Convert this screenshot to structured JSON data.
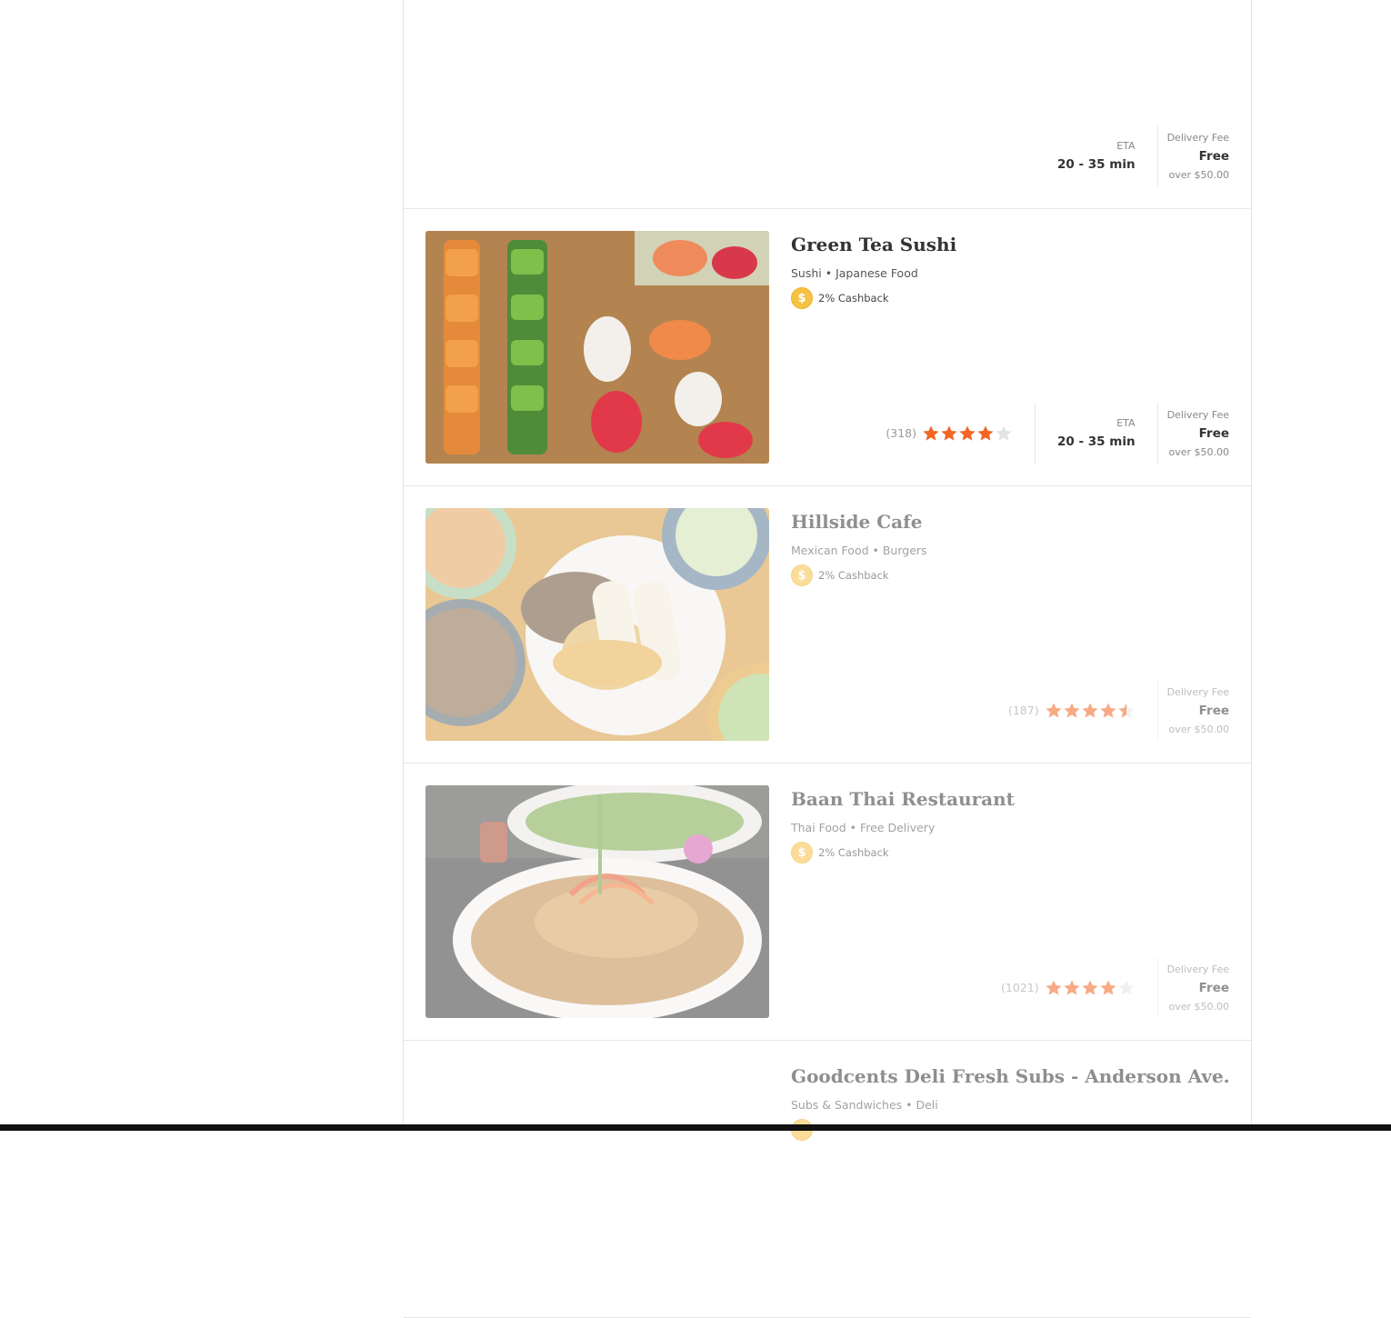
{
  "restaurants": [
    {
      "eta_label": "ETA",
      "eta_value": "20 - 35 min",
      "fee_label": "Delivery Fee",
      "fee_value": "Free",
      "fee_sub": "over $50.00"
    },
    {
      "name": "Green Tea Sushi",
      "cuisines": "Sushi • Japanese Food",
      "cashback": "2% Cashback",
      "review_count": "(318)",
      "rating": 4,
      "eta_label": "ETA",
      "eta_value": "20 - 35 min",
      "fee_label": "Delivery Fee",
      "fee_value": "Free",
      "fee_sub": "over $50.00"
    },
    {
      "name": "Hillside Cafe",
      "cuisines": "Mexican Food • Burgers",
      "cashback": "2% Cashback",
      "review_count": "(187)",
      "rating": 4.5,
      "fee_label": "Delivery Fee",
      "fee_value": "Free",
      "fee_sub": "over $50.00"
    },
    {
      "name": "Baan Thai Restaurant",
      "cuisines": "Thai Food • Free Delivery",
      "cashback": "2% Cashback",
      "review_count": "(1021)",
      "rating": 4,
      "fee_label": "Delivery Fee",
      "fee_value": "Free",
      "fee_sub": "over $50.00"
    },
    {
      "name": "Goodcents Deli Fresh Subs - Anderson Ave.",
      "cuisines": "Subs & Sandwiches • Deli"
    }
  ],
  "colors": {
    "star_on": "#f26522",
    "star_off": "#e3e3e3",
    "coin": "#f6c244"
  },
  "icons": {
    "coin": "cashback-coin-icon",
    "star": "star-icon"
  }
}
